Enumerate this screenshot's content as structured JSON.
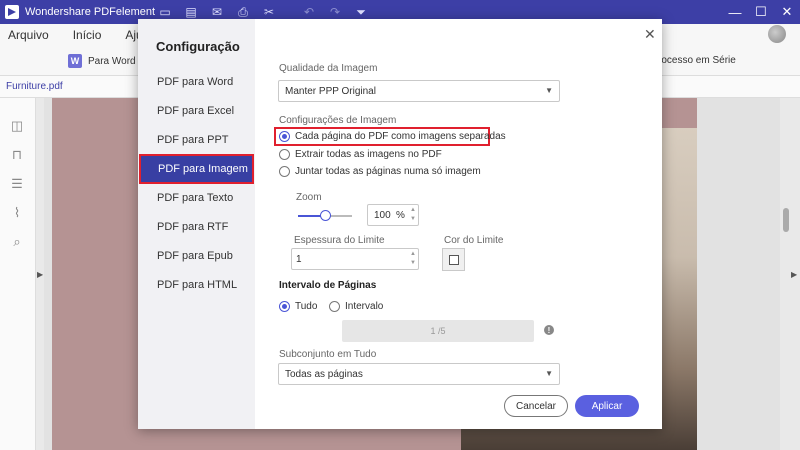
{
  "app": {
    "title": "Wondershare PDFelement",
    "window_controls": [
      "—",
      "☐",
      "✕"
    ]
  },
  "quick_toolbar": {
    "icons": [
      "folder-icon",
      "save-icon",
      "mail-icon",
      "print-icon",
      "scissors-icon",
      "undo-icon",
      "redo-icon",
      "dropdown-icon"
    ]
  },
  "menu": {
    "items": [
      "Arquivo",
      "Início",
      "Ajuda"
    ]
  },
  "toolbar": {
    "pdf_word_label": "Para Word",
    "batch_label": "rocesso em Série"
  },
  "tabs": {
    "doc_tab": "Furniture.pdf"
  },
  "dialog": {
    "title": "Configuração",
    "nav": [
      "PDF para Word",
      "PDF para Excel",
      "PDF para PPT",
      "PDF para Imagem",
      "PDF para Texto",
      "PDF para RTF",
      "PDF para Epub",
      "PDF para HTML"
    ],
    "active_nav_index": 3,
    "image_quality": {
      "label": "Qualidade da Imagem",
      "value": "Manter PPP Original"
    },
    "image_settings": {
      "label": "Configurações de Imagem",
      "options": [
        "Cada página do PDF como imagens separadas",
        "Extrair todas as imagens no PDF",
        "Juntar todas as páginas numa só imagem"
      ],
      "selected_index": 0
    },
    "zoom": {
      "label": "Zoom",
      "value": "100",
      "unit": "%",
      "slider_fraction": 0.48
    },
    "border_thickness": {
      "label": "Espessura do Limite",
      "value": "1"
    },
    "border_color": {
      "label": "Cor do Limite"
    },
    "page_range": {
      "title": "Intervalo de Páginas",
      "options": [
        "Tudo",
        "Intervalo"
      ],
      "selected_index": 0,
      "range_placeholder": "1 /5"
    },
    "subset": {
      "label": "Subconjunto em Tudo",
      "value": "Todas as páginas"
    },
    "buttons": {
      "cancel": "Cancelar",
      "apply": "Aplicar"
    },
    "close_label": "✕",
    "info_label": "!"
  },
  "colors": {
    "title_bar": "#3d3fa6",
    "accent": "#4a55d6",
    "highlight": "#e0202e",
    "apply_button": "#5a60e0"
  }
}
